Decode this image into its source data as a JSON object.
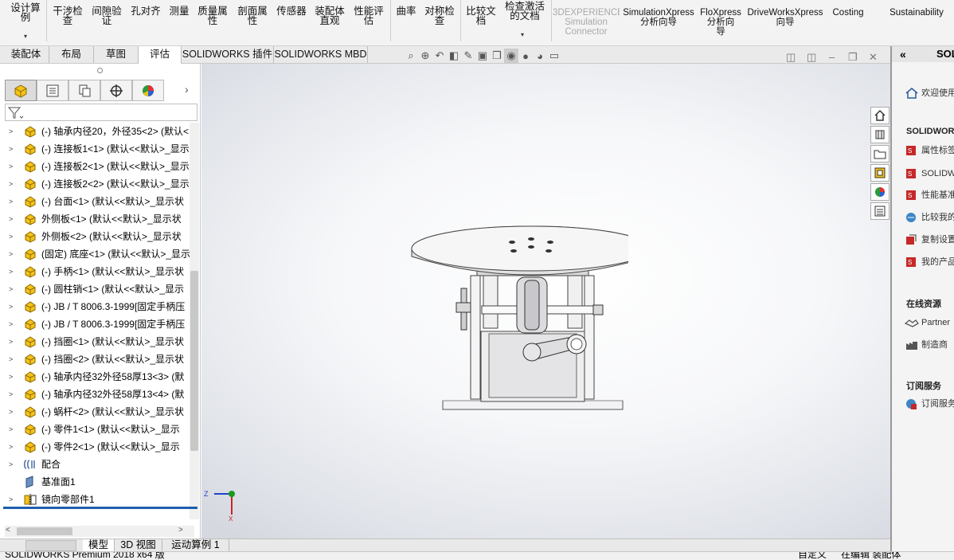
{
  "ribbon": {
    "design_study": "设计算\n例",
    "interference": "干涉检\n查",
    "clearance": "间隙验\n证",
    "hole_align": "孔对齐",
    "measure": "测量",
    "mass_props": "质量属\n性",
    "section_props": "剖面属\n性",
    "sensors": "传感器",
    "asm_visualization": "装配体\n直观",
    "perf_eval": "性能评\n估",
    "curvature": "曲率",
    "symmetry": "对称检\n查",
    "compare_docs": "比较文\n档",
    "check_active": "检查激活\n的文档",
    "sim_connector": "3DEXPERIENCE\nSimulation\nConnector",
    "simxpress": "SimulationXpress\n分析向导",
    "floxpress": "FloXpress\n分析向\n导",
    "driveworks": "DriveWorksXpress\n向导",
    "costing": "Costing",
    "sustainability": "Sustainability"
  },
  "tabs": [
    "装配体",
    "布局",
    "草图",
    "评估",
    "SOLIDWORKS 插件",
    "SOLIDWORKS MBD"
  ],
  "active_tab": "评估",
  "tree": {
    "items": [
      {
        "label": "(-) 轴承内径20，外径35<2> (默认<"
      },
      {
        "label": "(-) 连接板1<1> (默认<<默认>_显示"
      },
      {
        "label": "(-) 连接板2<1> (默认<<默认>_显示"
      },
      {
        "label": "(-) 连接板2<2> (默认<<默认>_显示"
      },
      {
        "label": "(-) 台面<1> (默认<<默认>_显示状"
      },
      {
        "label": "外侧板<1> (默认<<默认>_显示状"
      },
      {
        "label": "外侧板<2> (默认<<默认>_显示状"
      },
      {
        "label": "(固定) 底座<1> (默认<<默认>_显示"
      },
      {
        "label": "(-) 手柄<1> (默认<<默认>_显示状"
      },
      {
        "label": "(-) 圆柱销<1> (默认<<默认>_显示"
      },
      {
        "label": "(-) JB / T 8006.3-1999[固定手柄压"
      },
      {
        "label": "(-) JB / T 8006.3-1999[固定手柄压"
      },
      {
        "label": "(-) 挡圈<1> (默认<<默认>_显示状"
      },
      {
        "label": "(-) 挡圈<2> (默认<<默认>_显示状"
      },
      {
        "label": "(-) 轴承内径32外径58厚13<3> (默"
      },
      {
        "label": "(-) 轴承内径32外径58厚13<4> (默"
      },
      {
        "label": "(-) 蜗杆<2> (默认<<默认>_显示状"
      },
      {
        "label": "(-) 零件1<1> (默认<<默认>_显示"
      },
      {
        "label": "(-) 零件2<1> (默认<<默认>_显示"
      },
      {
        "label": "配合"
      },
      {
        "label": "基准面1"
      },
      {
        "label": "镜向零部件1"
      }
    ]
  },
  "bottom_tabs": [
    "模型",
    "3D 视图",
    "运动算例 1"
  ],
  "status": {
    "left": "SOLIDWORKS Premium 2018 x64 版",
    "custom": "自定义",
    "editing": "在编辑 装配体"
  },
  "task_pane": {
    "header": "SOL",
    "welcome": "欢迎使用",
    "sw_section": "SOLIDWOR",
    "sw_items": [
      "属性标签",
      "SOLIDW",
      "性能基准",
      "比较我的",
      "复制设置",
      "我的产品"
    ],
    "online_title": "在线资源",
    "online_items": [
      "Partner",
      "制造商"
    ],
    "sub_title": "订阅服务",
    "sub_items": [
      "订阅服务"
    ]
  },
  "triad": {
    "z": "Z",
    "x": "X"
  },
  "colors": {
    "accent_blue": "#1c5fb0",
    "part_yellow": "#f5c21a"
  }
}
